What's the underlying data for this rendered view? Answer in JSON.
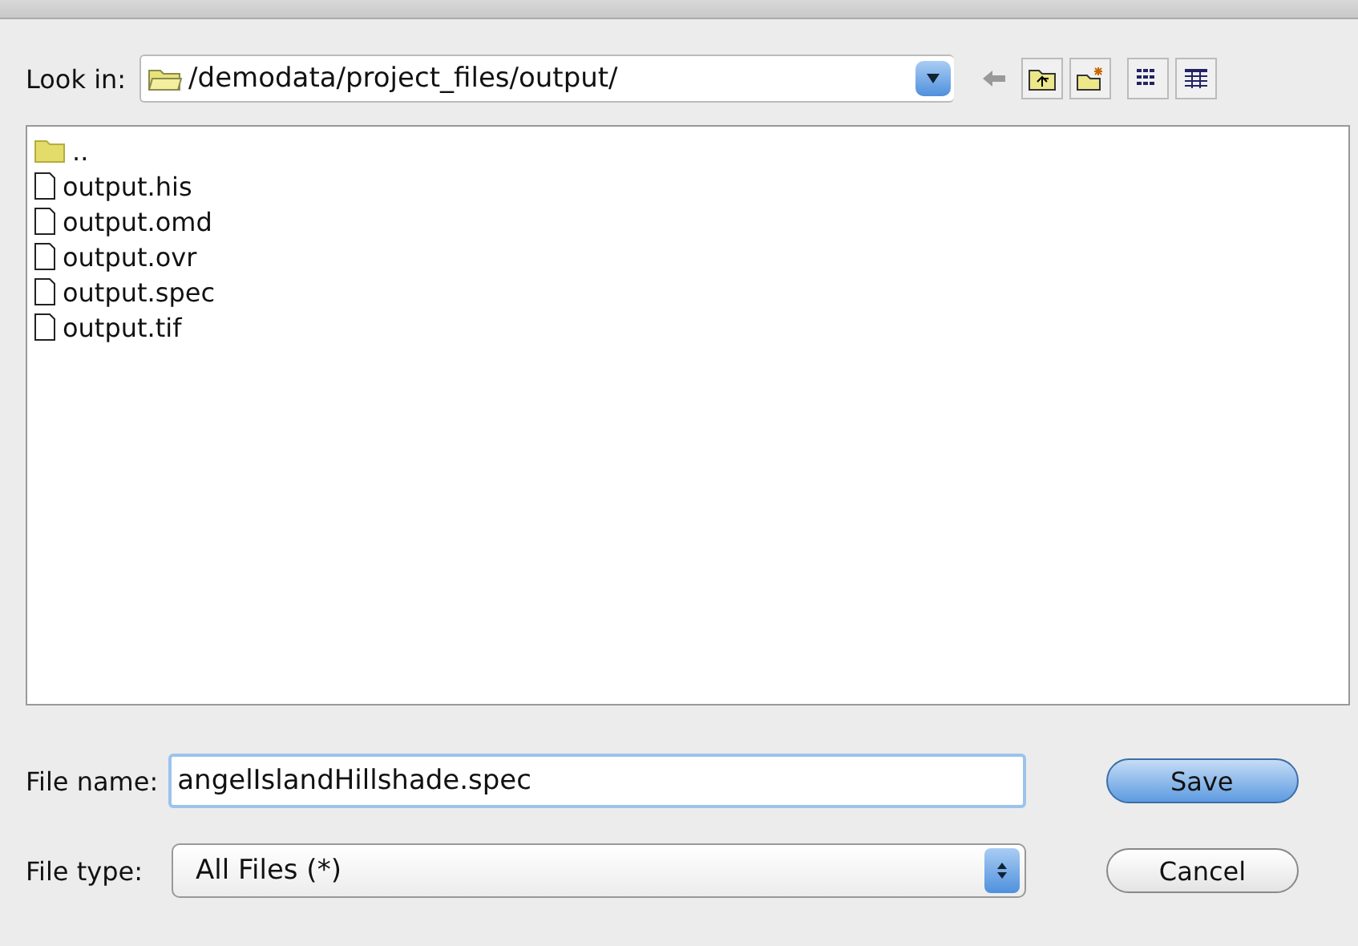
{
  "look_in": {
    "label": "Look in:",
    "path": "/demodata/project_files/output/"
  },
  "files": [
    {
      "kind": "folder",
      "name": ".."
    },
    {
      "kind": "file",
      "name": "output.his"
    },
    {
      "kind": "file",
      "name": "output.omd"
    },
    {
      "kind": "file",
      "name": "output.ovr"
    },
    {
      "kind": "file",
      "name": "output.spec"
    },
    {
      "kind": "file",
      "name": "output.tif"
    }
  ],
  "file_name": {
    "label": "File name:",
    "value": "angelIslandHillshade.spec"
  },
  "file_type": {
    "label": "File type:",
    "value": "All Files (*)"
  },
  "buttons": [
    {
      "label": "Save",
      "default": true
    },
    {
      "label": "Cancel",
      "default": false
    }
  ]
}
